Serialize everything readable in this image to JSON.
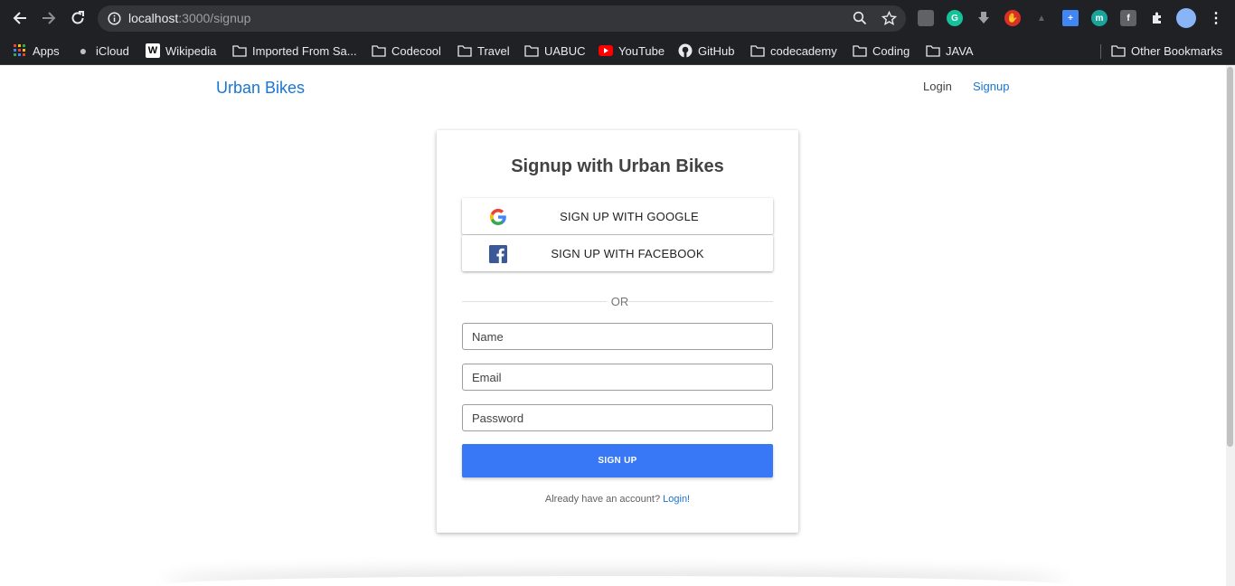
{
  "browser": {
    "url_host": "localhost",
    "url_rest": ":3000/signup",
    "bookmarks": [
      {
        "label": "Apps",
        "icon": "apps-grid-icon"
      },
      {
        "label": "iCloud",
        "icon": "apple-icon"
      },
      {
        "label": "Wikipedia",
        "icon": "wikipedia-icon"
      },
      {
        "label": "Imported From Sa...",
        "icon": "folder-icon"
      },
      {
        "label": "Codecool",
        "icon": "folder-icon"
      },
      {
        "label": "Travel",
        "icon": "folder-icon"
      },
      {
        "label": "UABUC",
        "icon": "folder-icon"
      },
      {
        "label": "YouTube",
        "icon": "youtube-icon"
      },
      {
        "label": "GitHub",
        "icon": "github-icon"
      },
      {
        "label": "codecademy",
        "icon": "folder-icon"
      },
      {
        "label": "Coding",
        "icon": "folder-icon"
      },
      {
        "label": "JAVA",
        "icon": "folder-icon"
      }
    ],
    "other_bookmarks": "Other Bookmarks"
  },
  "navbar": {
    "brand": "Urban Bikes",
    "login": "Login",
    "signup": "Signup"
  },
  "signup_card": {
    "title": "Signup with Urban Bikes",
    "google_label": "SIGN UP WITH GOOGLE",
    "facebook_label": "SIGN UP WITH FACEBOOK",
    "divider": "OR",
    "name_placeholder": "Name",
    "email_placeholder": "Email",
    "password_placeholder": "Password",
    "submit_label": "SIGN UP",
    "footer_text": "Already have an account? ",
    "footer_link": "Login!"
  },
  "colors": {
    "brand": "#1976d2",
    "submit": "#3877f6",
    "chrome": "#202124"
  }
}
